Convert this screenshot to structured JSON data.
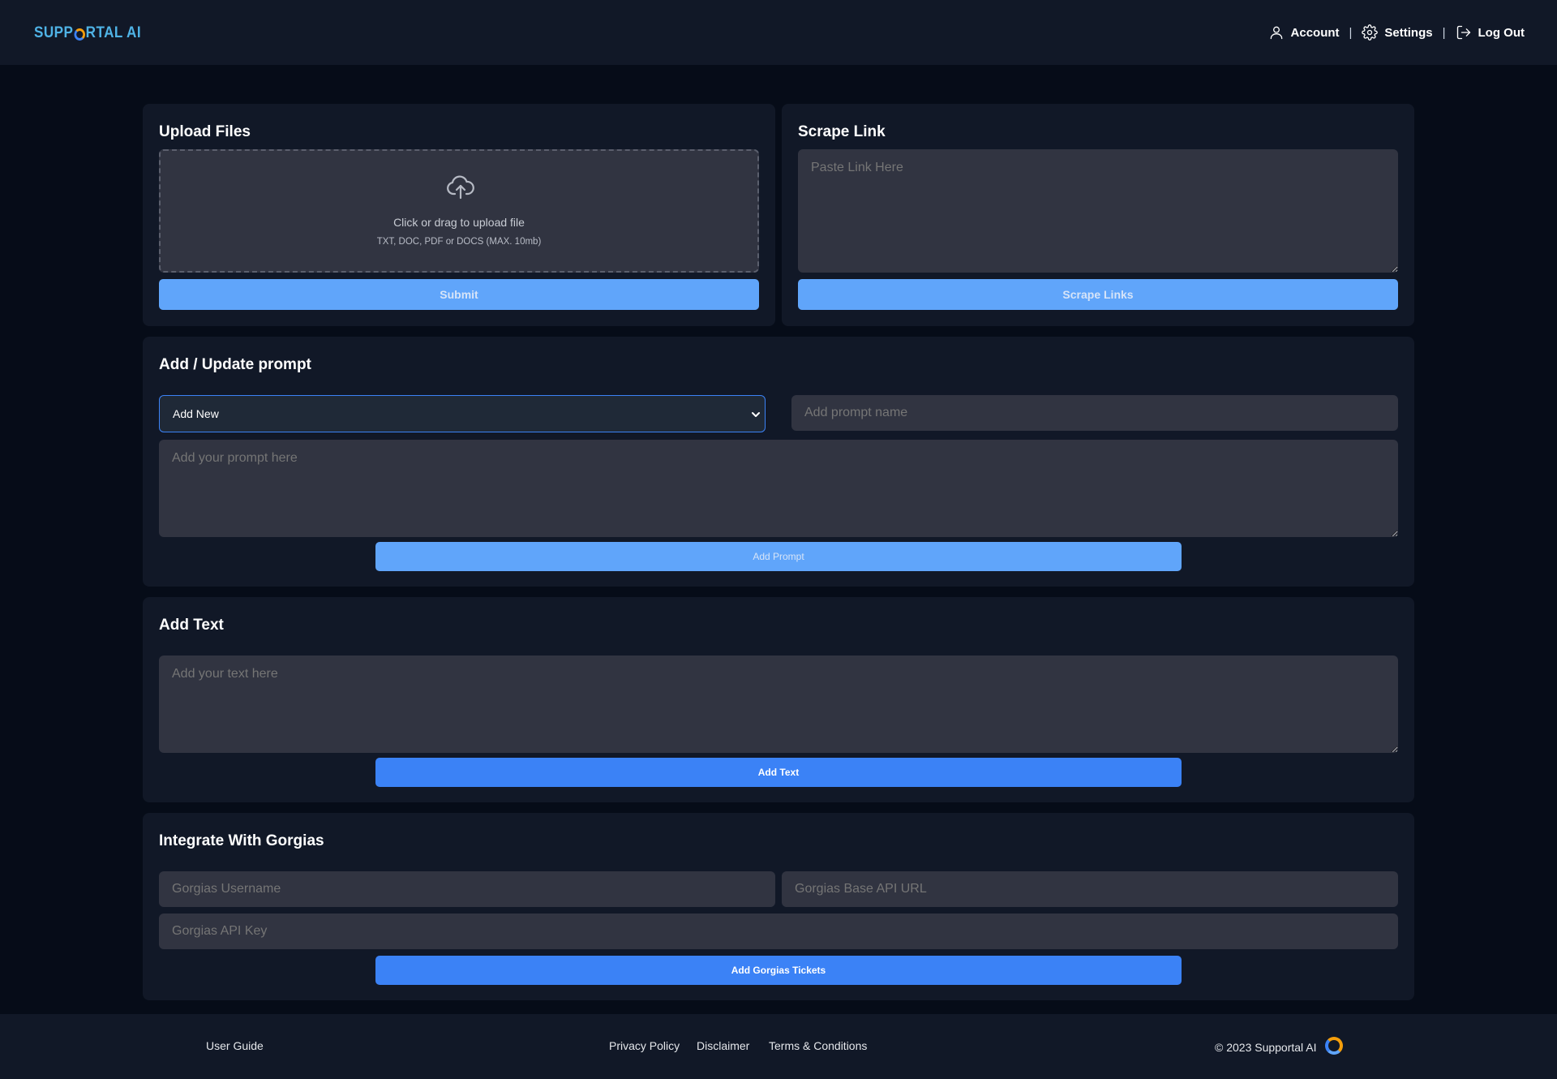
{
  "header": {
    "logo": {
      "before": "SUPP",
      "after": "RTAL AI"
    },
    "nav": {
      "account": "Account",
      "separator": "|",
      "settings": "Settings",
      "logout": "Log Out"
    }
  },
  "upload": {
    "title": "Upload Files",
    "drop_main": "Click or drag to upload file",
    "drop_sub": "TXT, DOC, PDF or DOCS (MAX. 10mb)",
    "submit_label": "Submit"
  },
  "scrape": {
    "title": "Scrape Link",
    "placeholder": "Paste Link Here",
    "button_label": "Scrape Links"
  },
  "prompt": {
    "title": "Add / Update prompt",
    "select_value": "Add New",
    "name_placeholder": "Add prompt name",
    "text_placeholder": "Add your prompt here",
    "button_label": "Add Prompt"
  },
  "text": {
    "title": "Add Text",
    "placeholder": "Add your text here",
    "button_label": "Add Text"
  },
  "gorgias": {
    "title": "Integrate With Gorgias",
    "username_placeholder": "Gorgias Username",
    "base_url_placeholder": "Gorgias Base API URL",
    "api_key_placeholder": "Gorgias API Key",
    "button_label": "Add Gorgias Tickets"
  },
  "footer": {
    "user_guide": "User Guide",
    "privacy": "Privacy Policy",
    "disclaimer": "Disclaimer",
    "terms": "Terms & Conditions",
    "copyright": "© 2023 Supportal AI"
  },
  "colors": {
    "background": "#060c18",
    "card": "#111827",
    "field": "#313441",
    "accent": "#3b82f6",
    "accent_light": "#60a5fa"
  }
}
